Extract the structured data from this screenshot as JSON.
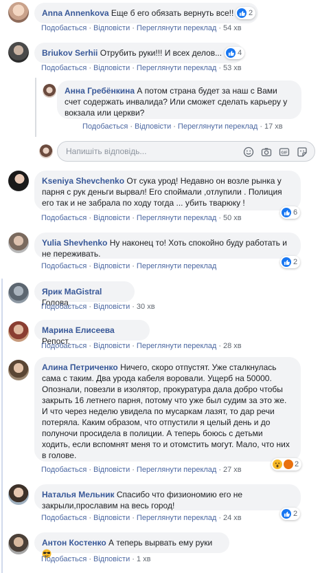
{
  "actions": {
    "like": "Подобається",
    "reply": "Відповісти",
    "view_translation": "Переглянути переклад"
  },
  "comments": [
    {
      "author": "Anna Annenkova",
      "text": "Еще б его обязать вернуть все!!",
      "time": "54 хв",
      "reactions": "2"
    },
    {
      "author": "Briukov Serhii",
      "text": "Отрубить руки!!! И всех делов...",
      "time": "53 хв",
      "reactions": "4"
    },
    {
      "author": "Анна Гребёнкина",
      "text": "А потом страна будет за наш с Вами счет содержать инвалида? Или сможет сделать карьеру у вокзала или церкви?",
      "time": "17 хв"
    },
    {
      "author": "Kseniya Shevchenko",
      "text": "От сука урод! Недавно он возле рынка у парня с рук деньги вырвал! Его споймали ,отлупили . Полиция его так и не забрала по ходу тогда ... убить тварюку !",
      "time": "50 хв",
      "reactions": "6"
    },
    {
      "author": "Yulia Shevhenko",
      "text": "Ну наконец то! Хоть спокойно буду работать и не переживать.",
      "time": "",
      "reactions": "2"
    },
    {
      "author": "Ярик MaGistral",
      "text": "Голова",
      "time": "30 хв"
    },
    {
      "author": "Марина Елисеева",
      "text": "Репост.",
      "time": "28 хв"
    },
    {
      "author": "Алина Петриченко",
      "text": "Ничего, скоро отпустят. Уже сталкнулась сама с таким. Два урода кабеля воровали. Ущерб на 50000. Опознали, повезли в изолятор, прокуратура дала добро чтобы закрыть 16 летнего парня, потому что уже был судим за это же. И что через неделю увидела по мусаркам лазят, то дар речи потеряла. Каким образом, что отпустили я целый день и до полуночи просидела в полиции. А теперь боюсь с детьми ходить, если вспомнят меня то и отомстить могут. Мало, что них в голове.",
      "time": "27 хв",
      "reactions": "2"
    },
    {
      "author": "Наталья Мельник",
      "text": "Спасибо что физиономию его не закрыли,прославим на весь город!",
      "time": "24 хв",
      "reactions": "2"
    },
    {
      "author": "Антон Костенко",
      "text": "А теперь вырвать ему руки",
      "time": "1 хв"
    }
  ],
  "reply_box": {
    "placeholder": "Напишіть відповідь..."
  },
  "icons": [
    "like-icon",
    "wow-icon",
    "emoji-icon",
    "camera-icon",
    "gif-icon",
    "sticker-icon",
    "sunglasses-emoji-icon"
  ],
  "colors": {
    "name": "#385898",
    "link": "#4b67a1",
    "bubble": "#f2f3f5",
    "like": "#1877f2"
  }
}
